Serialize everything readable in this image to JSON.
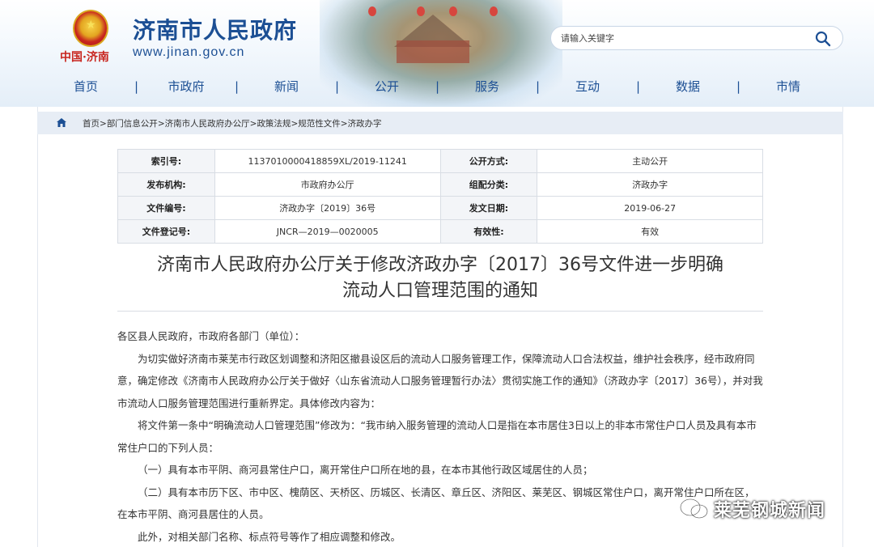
{
  "header": {
    "emblem_text": "中国·济南",
    "site_name": "济南市人民政府",
    "site_url": "www.jinan.gov.cn",
    "search_placeholder": "请输入关键字"
  },
  "nav": [
    "首页",
    "市政府",
    "新闻",
    "公开",
    "服务",
    "互动",
    "数据",
    "市情"
  ],
  "breadcrumb": [
    "首页",
    "部门信息公开",
    "济南市人民政府办公厅",
    "政策法规",
    "规范性文件",
    "济政办字"
  ],
  "meta": [
    {
      "l1": "索引号:",
      "v1": "113701000041885​9XL/2019-11241",
      "l2": "公开方式:",
      "v2": "主动公开"
    },
    {
      "l1": "发布机构:",
      "v1": "市政府办公厅",
      "l2": "组配分类:",
      "v2": "济政办字"
    },
    {
      "l1": "文件编号:",
      "v1": "济政办字〔2019〕36号",
      "l2": "发文日期:",
      "v2": "2019-06-27"
    },
    {
      "l1": "文件登记号:",
      "v1": "JNCR—2019—0020005",
      "l2": "有效性:",
      "v2": "有效"
    }
  ],
  "title_line1": "济南市人民政府办公厅关于修改济政办字〔2017〕36号文件进一步明确",
  "title_line2": "流动人口管理范围的通知",
  "paragraphs": {
    "salutation": "各区县人民政府，市政府各部门（单位）：",
    "p1": "为切实做好济南市莱芜市行政区划调整和济阳区撤县设区后的流动人口服务管理工作，保障流动人口合法权益，维护社会秩序，经市政府同意，确定修改《济南市人民政府办公厅关于做好〈山东省流动人口服务管理暂行办法〉贯彻实施工作的通知》（济政办字〔2017〕36号），并对我市流动人口服务管理范围进行重新界定。具体修改内容为：",
    "p2": "将文件第一条中“明确流动人口管理范围”修改为：“我市纳入服务管理的流动人口是指在本市居住3日以上的非本市常住户口人员及具有本市常住户口的下列人员：",
    "p3": "（一）具有本市平阴、商河县常住户口，离开常住户口所在地的县，在本市其他行政区域居住的人员；",
    "p4": "（二）具有本市历下区、市中区、槐荫区、天桥区、历城区、长清区、章丘区、济阳区、莱芜区、钢城区常住户口，离开常住户口所在区，在本市平阴、商河县居住的人员。",
    "p5": "此外，对相关部门名称、标点符号等作了相应调整和修改。"
  },
  "watermark": "莱芜钢城新闻"
}
